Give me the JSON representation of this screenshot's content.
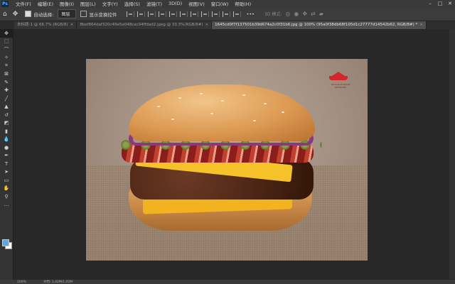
{
  "menubar": {
    "logo": "Ps",
    "items": [
      "文件(F)",
      "编辑(E)",
      "图像(I)",
      "图层(L)",
      "文字(Y)",
      "选择(S)",
      "滤镜(T)",
      "3D(D)",
      "视图(V)",
      "窗口(W)",
      "帮助(H)"
    ],
    "window_controls": [
      "–",
      "□",
      "✕"
    ]
  },
  "options": {
    "auto_select_label": "自动选择:",
    "auto_select_checked": true,
    "select_value": "图层",
    "transform_label": "显示变换控件",
    "transform_checked": false,
    "more": "•••",
    "mode_3d": "3D 模式:"
  },
  "tabs": [
    {
      "label": "未标题-1 @ 66.7% (RGB/8)",
      "close": "×",
      "active": false
    },
    {
      "label": "8bef864daf320c49e5a048cac04ffdad2.jpeg @ 33.3%(RGB/8#)",
      "close": "×",
      "active": false
    },
    {
      "label": "1645cd0f7f137501b39d674a2c0f31b6.jpg @ 100% (95a0f38db68f105d1c27777d14542b62, RGB/8#) *",
      "close": "×",
      "active": true
    }
  ],
  "tools": [
    {
      "icon": "move-icon",
      "glyph": "✥"
    },
    {
      "icon": "artboard-icon",
      "glyph": "⬚"
    },
    {
      "icon": "lasso-icon",
      "glyph": "⌒"
    },
    {
      "icon": "magic-wand-icon",
      "glyph": "✧"
    },
    {
      "icon": "crop-icon",
      "glyph": "⌗"
    },
    {
      "icon": "frame-icon",
      "glyph": "⊠"
    },
    {
      "icon": "eyedropper-icon",
      "glyph": "✎"
    },
    {
      "icon": "healing-brush-icon",
      "glyph": "✚"
    },
    {
      "icon": "brush-icon",
      "glyph": "╱"
    },
    {
      "icon": "stamp-icon",
      "glyph": "▲"
    },
    {
      "icon": "history-brush-icon",
      "glyph": "↺"
    },
    {
      "icon": "eraser-icon",
      "glyph": "◩"
    },
    {
      "icon": "gradient-icon",
      "glyph": "▮"
    },
    {
      "icon": "blur-icon",
      "glyph": "💧"
    },
    {
      "icon": "dodge-icon",
      "glyph": "●"
    },
    {
      "icon": "pen-icon",
      "glyph": "✒"
    },
    {
      "icon": "type-icon",
      "glyph": "T"
    },
    {
      "icon": "path-select-icon",
      "glyph": "➤"
    },
    {
      "icon": "rectangle-icon",
      "glyph": "▭"
    },
    {
      "icon": "hand-icon",
      "glyph": "✋"
    },
    {
      "icon": "zoom-icon",
      "glyph": "⚲"
    },
    {
      "icon": "more-tools-icon",
      "glyph": "…"
    }
  ],
  "colors": {
    "foreground": "#62a6d8",
    "background": "#ffffff",
    "watermark": "#d2262b"
  },
  "watermark_text": "RELX EDUCATION NETWORK",
  "status": {
    "zoom": "100%",
    "doc": "文档: 1.02M/1.02M"
  }
}
